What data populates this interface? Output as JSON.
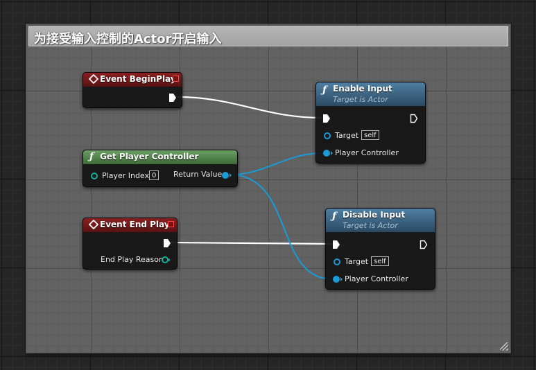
{
  "comment": {
    "title": "为接受输入控制的Actor开启输入",
    "color": "#a8a8a8"
  },
  "colors": {
    "exec_wire": "#ffffff",
    "object_wire": "#1a9bd7",
    "event_header": "#8a2020",
    "pure_header": "#5a8b54",
    "function_header": "#3f6b8c",
    "byte_pin": "#0fb39b"
  },
  "nodes": {
    "begin_play": {
      "title": "Event BeginPlay",
      "icon": "event-diamond-icon"
    },
    "get_player_controller": {
      "title": "Get Player Controller",
      "player_index_label": "Player Index",
      "player_index_value": "0",
      "return_value_label": "Return Value"
    },
    "end_play": {
      "title": "Event End Play",
      "reason_label": "End Play Reason"
    },
    "enable_input": {
      "title": "Enable Input",
      "subtitle": "Target is Actor",
      "target_label": "Target",
      "target_value": "self",
      "controller_label": "Player Controller"
    },
    "disable_input": {
      "title": "Disable Input",
      "subtitle": "Target is Actor",
      "target_label": "Target",
      "target_value": "self",
      "controller_label": "Player Controller"
    }
  }
}
